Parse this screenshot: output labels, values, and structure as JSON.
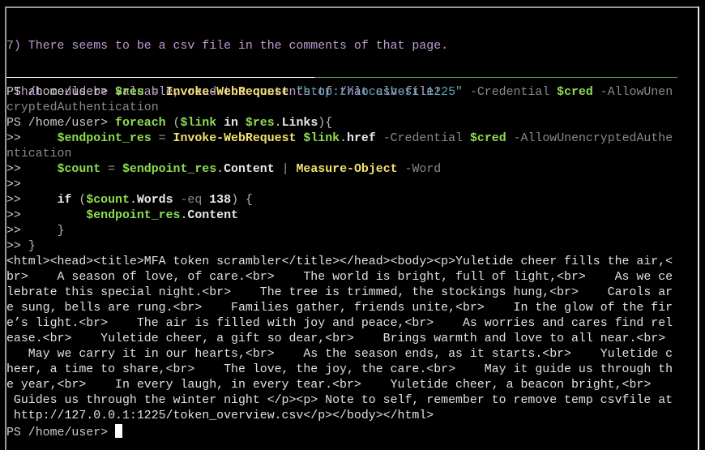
{
  "instructions": {
    "line1": "7) There seems to be a csv file in the comments of that page.",
    "line2": " That could be valuable, read the contents of that csv-file!"
  },
  "prompt": "PS /home/user> ",
  "continuation": ">>",
  "commands": {
    "cmd1": {
      "var": "$res",
      "assign": " = ",
      "cmdlet": "Invoke-WebRequest",
      "url": "\"http://localhost:1225\"",
      "param_credential": "-Credential",
      "cred_var": "$cred",
      "param_allow_part1": "-AllowUnen",
      "param_allow_part2": "cryptedAuthentication"
    },
    "cmd2": {
      "keyword": "foreach",
      "open": " (",
      "link_var": "$link",
      "in": " in ",
      "res_var": "$res",
      "dot": ".",
      "prop": "Links",
      "close": "){"
    },
    "cmd3": {
      "indent": "     ",
      "var": "$endpoint_res",
      "assign": " = ",
      "cmdlet": "Invoke-WebRequest",
      "link_var": "$link",
      "dot": ".",
      "prop": "href",
      "param_credential": "-Credential",
      "cred_var": "$cred",
      "param_allow_part1": "-AllowUnencryptedAuthe",
      "param_allow_part2": "ntication"
    },
    "cmd4": {
      "indent": "     ",
      "var": "$count",
      "assign": " = ",
      "src_var": "$endpoint_res",
      "dot": ".",
      "prop": "Content",
      "pipe": " | ",
      "cmdlet": "Measure-Object",
      "param": "-Word"
    },
    "cmd5": {
      "indent": "     ",
      "keyword": "if",
      "open": " (",
      "var": "$count",
      "dot": ".",
      "prop": "Words",
      "op": "-eq",
      "num": "138",
      "close": ") {"
    },
    "cmd6": {
      "indent": "         ",
      "var": "$endpoint_res",
      "dot": ".",
      "prop": "Content"
    },
    "cmd7": {
      "indent": "     ",
      "brace": "}"
    },
    "cmd8": {
      "indent": " ",
      "brace": "}"
    }
  },
  "output_lines": [
    "<html><head><title>MFA token scrambler</title></head><body><p>Yuletide cheer fills the air,<",
    "br>    A season of love, of care.<br>    The world is bright, full of light,<br>    As we ce",
    "lebrate this special night.<br>    The tree is trimmed, the stockings hung,<br>    Carols ar",
    "e sung, bells are rung.<br>    Families gather, friends unite,<br>    In the glow of the fir",
    "e’s light.<br>    The air is filled with joy and peace,<br>    As worries and cares find rel",
    "ease.<br>    Yuletide cheer, a gift so dear,<br>    Brings warmth and love to all near.<br>",
    "   May we carry it in our hearts,<br>    As the season ends, as it starts.<br>    Yuletide c",
    "heer, a time to share,<br>    The love, the joy, the care.<br>    May it guide us through th",
    "e year,<br>    In every laugh, in every tear.<br>    Yuletide cheer, a beacon bright,<br>",
    " Guides us through the winter night </p><p> Note to self, remember to remove temp csvfile at",
    " http://127.0.0.1:1225/token_overview.csv</p></body></html>"
  ],
  "final_prompt": "PS /home/user> "
}
